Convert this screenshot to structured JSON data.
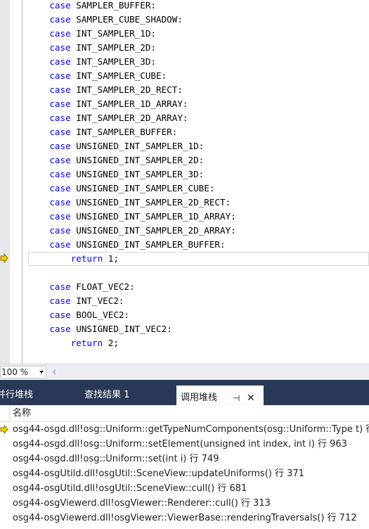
{
  "editor": {
    "lines": [
      {
        "kw": "case",
        "text": " SAMPLER_BUFFER:",
        "indent": "    "
      },
      {
        "kw": "case",
        "text": " SAMPLER_CUBE_SHADOW:",
        "indent": "    "
      },
      {
        "kw": "case",
        "text": " INT_SAMPLER_1D:",
        "indent": "    "
      },
      {
        "kw": "case",
        "text": " INT_SAMPLER_2D:",
        "indent": "    "
      },
      {
        "kw": "case",
        "text": " INT_SAMPLER_3D:",
        "indent": "    "
      },
      {
        "kw": "case",
        "text": " INT_SAMPLER_CUBE:",
        "indent": "    "
      },
      {
        "kw": "case",
        "text": " INT_SAMPLER_2D_RECT:",
        "indent": "    "
      },
      {
        "kw": "case",
        "text": " INT_SAMPLER_1D_ARRAY:",
        "indent": "    "
      },
      {
        "kw": "case",
        "text": " INT_SAMPLER_2D_ARRAY:",
        "indent": "    "
      },
      {
        "kw": "case",
        "text": " INT_SAMPLER_BUFFER:",
        "indent": "    "
      },
      {
        "kw": "case",
        "text": " UNSIGNED_INT_SAMPLER_1D:",
        "indent": "    "
      },
      {
        "kw": "case",
        "text": " UNSIGNED_INT_SAMPLER_2D:",
        "indent": "    "
      },
      {
        "kw": "case",
        "text": " UNSIGNED_INT_SAMPLER_3D:",
        "indent": "    "
      },
      {
        "kw": "case",
        "text": " UNSIGNED_INT_SAMPLER_CUBE:",
        "indent": "    "
      },
      {
        "kw": "case",
        "text": " UNSIGNED_INT_SAMPLER_2D_RECT:",
        "indent": "    "
      },
      {
        "kw": "case",
        "text": " UNSIGNED_INT_SAMPLER_1D_ARRAY:",
        "indent": "    "
      },
      {
        "kw": "case",
        "text": " UNSIGNED_INT_SAMPLER_2D_ARRAY:",
        "indent": "    "
      },
      {
        "kw": "case",
        "text": " UNSIGNED_INT_SAMPLER_BUFFER:",
        "indent": "    "
      },
      {
        "kw": "return",
        "text": " 1;",
        "indent": "        ",
        "current": true
      },
      {
        "kw": "",
        "text": "",
        "indent": ""
      },
      {
        "kw": "case",
        "text": " FLOAT_VEC2:",
        "indent": "    "
      },
      {
        "kw": "case",
        "text": " INT_VEC2:",
        "indent": "    "
      },
      {
        "kw": "case",
        "text": " BOOL_VEC2:",
        "indent": "    "
      },
      {
        "kw": "case",
        "text": " UNSIGNED_INT_VEC2:",
        "indent": "    "
      },
      {
        "kw": "return",
        "text": " 2;",
        "indent": "        "
      }
    ],
    "execution_arrow_icon": "current-statement-arrow-icon"
  },
  "zoom": {
    "value": "100 %"
  },
  "toolwindow": {
    "tabs": [
      {
        "label": "并行堆栈",
        "visible_label": "并行堆栈",
        "active": false
      },
      {
        "label": "查找结果 1",
        "active": false
      },
      {
        "label": "调用堆栈",
        "active": true
      }
    ],
    "pin_icon": "pin-icon",
    "close_icon": "close-icon"
  },
  "callstack": {
    "column_header": "名称",
    "rows": [
      {
        "text": "osg44-osgd.dll!osg::Uniform::getTypeNumComponents(osg::Uniform::Type t) 行",
        "current": true
      },
      {
        "text": "osg44-osgd.dll!osg::Uniform::setElement(unsigned int index, int i) 行 963",
        "current": false
      },
      {
        "text": "osg44-osgd.dll!osg::Uniform::set(int i) 行 749",
        "current": false
      },
      {
        "text": "osg44-osgUtild.dll!osgUtil::SceneView::updateUniforms() 行 371",
        "current": false
      },
      {
        "text": "osg44-osgUtild.dll!osgUtil::SceneView::cull() 行 681",
        "current": false
      },
      {
        "text": "osg44-osgViewerd.dll!osgViewer::Renderer::cull() 行 313",
        "current": false
      },
      {
        "text": "osg44-osgViewerd.dll!osgViewer::ViewerBase::renderingTraversals() 行 712",
        "current": false
      }
    ]
  },
  "colors": {
    "keyword": "#0000ff",
    "tab_strip": "#293955",
    "arrow_fill": "#f5d000",
    "arrow_stroke": "#8a6d00"
  }
}
